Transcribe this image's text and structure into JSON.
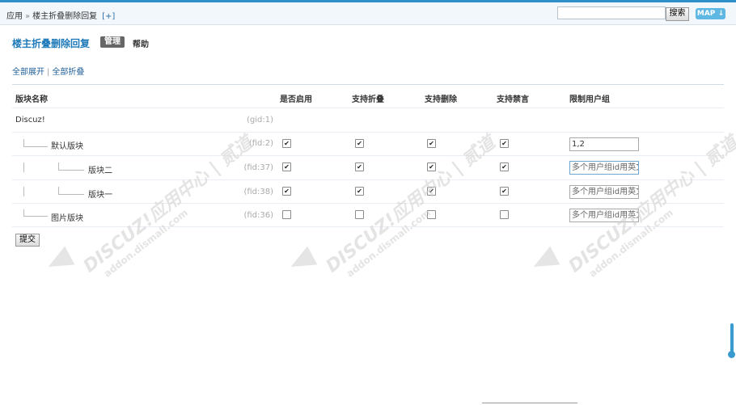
{
  "breadcrumb": {
    "root": "应用",
    "sep": "»",
    "current": "楼主折叠删除回复",
    "plus": "[+]"
  },
  "search": {
    "value": "",
    "button": "搜索"
  },
  "map_button": "MAP",
  "page": {
    "title": "楼主折叠删除回复",
    "tab_manage": "管理",
    "tab_help": "帮助"
  },
  "links": {
    "expand_all": "全部展开",
    "collapse_all": "全部折叠",
    "divider": "|"
  },
  "table": {
    "headers": [
      "版块名称",
      "是否启用",
      "支持折叠",
      "支持删除",
      "支持禁言",
      "限制用户组"
    ],
    "rows": [
      {
        "name": "Discuz!",
        "id": "(gid:1)",
        "level": "group"
      },
      {
        "name": "默认版块",
        "id": "(fid:2)",
        "enabled": true,
        "fold": true,
        "delete": true,
        "ban": true,
        "groups": "1,2"
      },
      {
        "name": "版块二",
        "id": "(fid:37)",
        "enabled": true,
        "fold": true,
        "delete": true,
        "ban": true,
        "groups": "",
        "placeholder": "多个用户组id用英文"
      },
      {
        "name": "版块一",
        "id": "(fid:38)",
        "enabled": true,
        "fold": true,
        "delete": true,
        "ban": true,
        "groups": "",
        "placeholder": "多个用户组id用英文"
      },
      {
        "name": "图片版块",
        "id": "(fid:36)",
        "enabled": false,
        "fold": false,
        "delete": false,
        "ban": false,
        "groups": "",
        "placeholder": "多个用户组id用英文"
      }
    ],
    "submit": "提交"
  },
  "watermark": {
    "brand": "DISCUZ!应用中心 | 贰道",
    "domain": "addon.dismall.com"
  }
}
